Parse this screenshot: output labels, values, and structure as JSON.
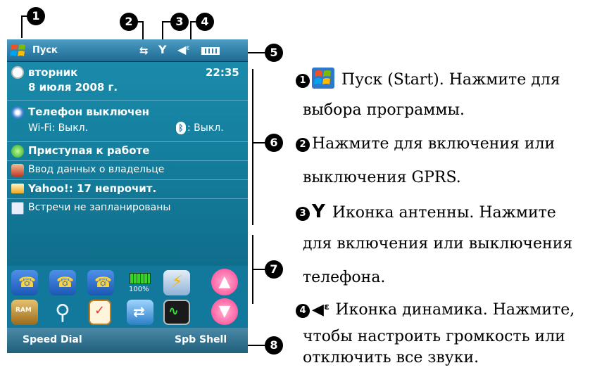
{
  "callouts": [
    "1",
    "2",
    "3",
    "4",
    "5",
    "6",
    "7",
    "8"
  ],
  "taskbar": {
    "start_label": "Пуск"
  },
  "today": {
    "day": "вторник",
    "date": "8 июля 2008 г.",
    "time": "22:35",
    "phone_status": "Телефон выключен",
    "wifi": "Wi-Fi: Выкл.",
    "bluetooth": ": Выкл.",
    "getting_started": "Приступая к работе",
    "owner": "Ввод данных о владельце",
    "mail": "Yahoo!: 17 непрочит.",
    "appointments": "Встречи не запланированы"
  },
  "icons": {
    "battery_label": "100%"
  },
  "softkeys": {
    "left": "Speed Dial",
    "right": "Spb Shell"
  },
  "description": {
    "item1": "Пуск (Start). Нажмите для",
    "item1b": "выбора программы.",
    "item2": "Нажмите для включения или",
    "item2b": "выключения GPRS.",
    "item3": "Иконка антенны. Нажмите",
    "item3b": "для включения или выключения",
    "item3c": "телефона.",
    "item4": "Иконка динамика. Нажмите,",
    "item4b": "чтобы настроить громкость или",
    "item4c": "отключить все звуки."
  },
  "colors": {
    "screen": "#12789a",
    "accent_green": "#3fbf3a",
    "pink": "#ff4f9a"
  }
}
